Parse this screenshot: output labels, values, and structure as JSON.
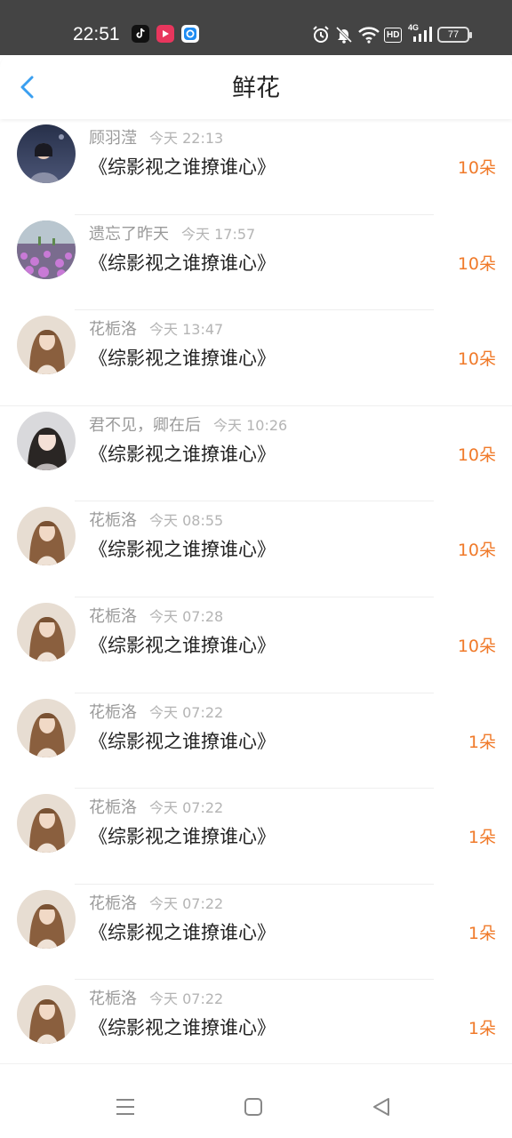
{
  "status_bar": {
    "time": "22:51",
    "apps": [
      "tiktok-icon",
      "video-app-icon",
      "browser-app-icon"
    ],
    "indicators": [
      "alarm-icon",
      "mute-icon",
      "wifi-icon",
      "hd-icon",
      "signal-4g-icon"
    ],
    "hd_label": "HD",
    "net_label": "4G",
    "battery": "77"
  },
  "header": {
    "title": "鲜花"
  },
  "colors": {
    "accent": "#3a9ff0",
    "count": "#f07a2a",
    "status_bg": "#444444"
  },
  "items": [
    {
      "user": "顾羽滢",
      "time": "今天 22:13",
      "book": "《综影视之谁撩谁心》",
      "count": "10朵",
      "avatar": "night-girl"
    },
    {
      "user": "遗忘了昨天",
      "time": "今天 17:57",
      "book": "《综影视之谁撩谁心》",
      "count": "10朵",
      "avatar": "flower-field"
    },
    {
      "user": "花栀洛",
      "time": "今天 13:47",
      "book": "《综影视之谁撩谁心》",
      "count": "10朵",
      "avatar": "long-hair-girl"
    },
    {
      "user": "君不见，卿在后",
      "time": "今天 10:26",
      "book": "《综影视之谁撩谁心》",
      "count": "10朵",
      "avatar": "selfie-girl"
    },
    {
      "user": "花栀洛",
      "time": "今天 08:55",
      "book": "《综影视之谁撩谁心》",
      "count": "10朵",
      "avatar": "long-hair-girl"
    },
    {
      "user": "花栀洛",
      "time": "今天 07:28",
      "book": "《综影视之谁撩谁心》",
      "count": "10朵",
      "avatar": "long-hair-girl"
    },
    {
      "user": "花栀洛",
      "time": "今天 07:22",
      "book": "《综影视之谁撩谁心》",
      "count": "1朵",
      "avatar": "long-hair-girl"
    },
    {
      "user": "花栀洛",
      "time": "今天 07:22",
      "book": "《综影视之谁撩谁心》",
      "count": "1朵",
      "avatar": "long-hair-girl"
    },
    {
      "user": "花栀洛",
      "time": "今天 07:22",
      "book": "《综影视之谁撩谁心》",
      "count": "1朵",
      "avatar": "long-hair-girl"
    },
    {
      "user": "花栀洛",
      "time": "今天 07:22",
      "book": "《综影视之谁撩谁心》",
      "count": "1朵",
      "avatar": "long-hair-girl"
    }
  ],
  "bottom_nav": [
    "menu-icon",
    "home-icon",
    "back-triangle-icon"
  ]
}
